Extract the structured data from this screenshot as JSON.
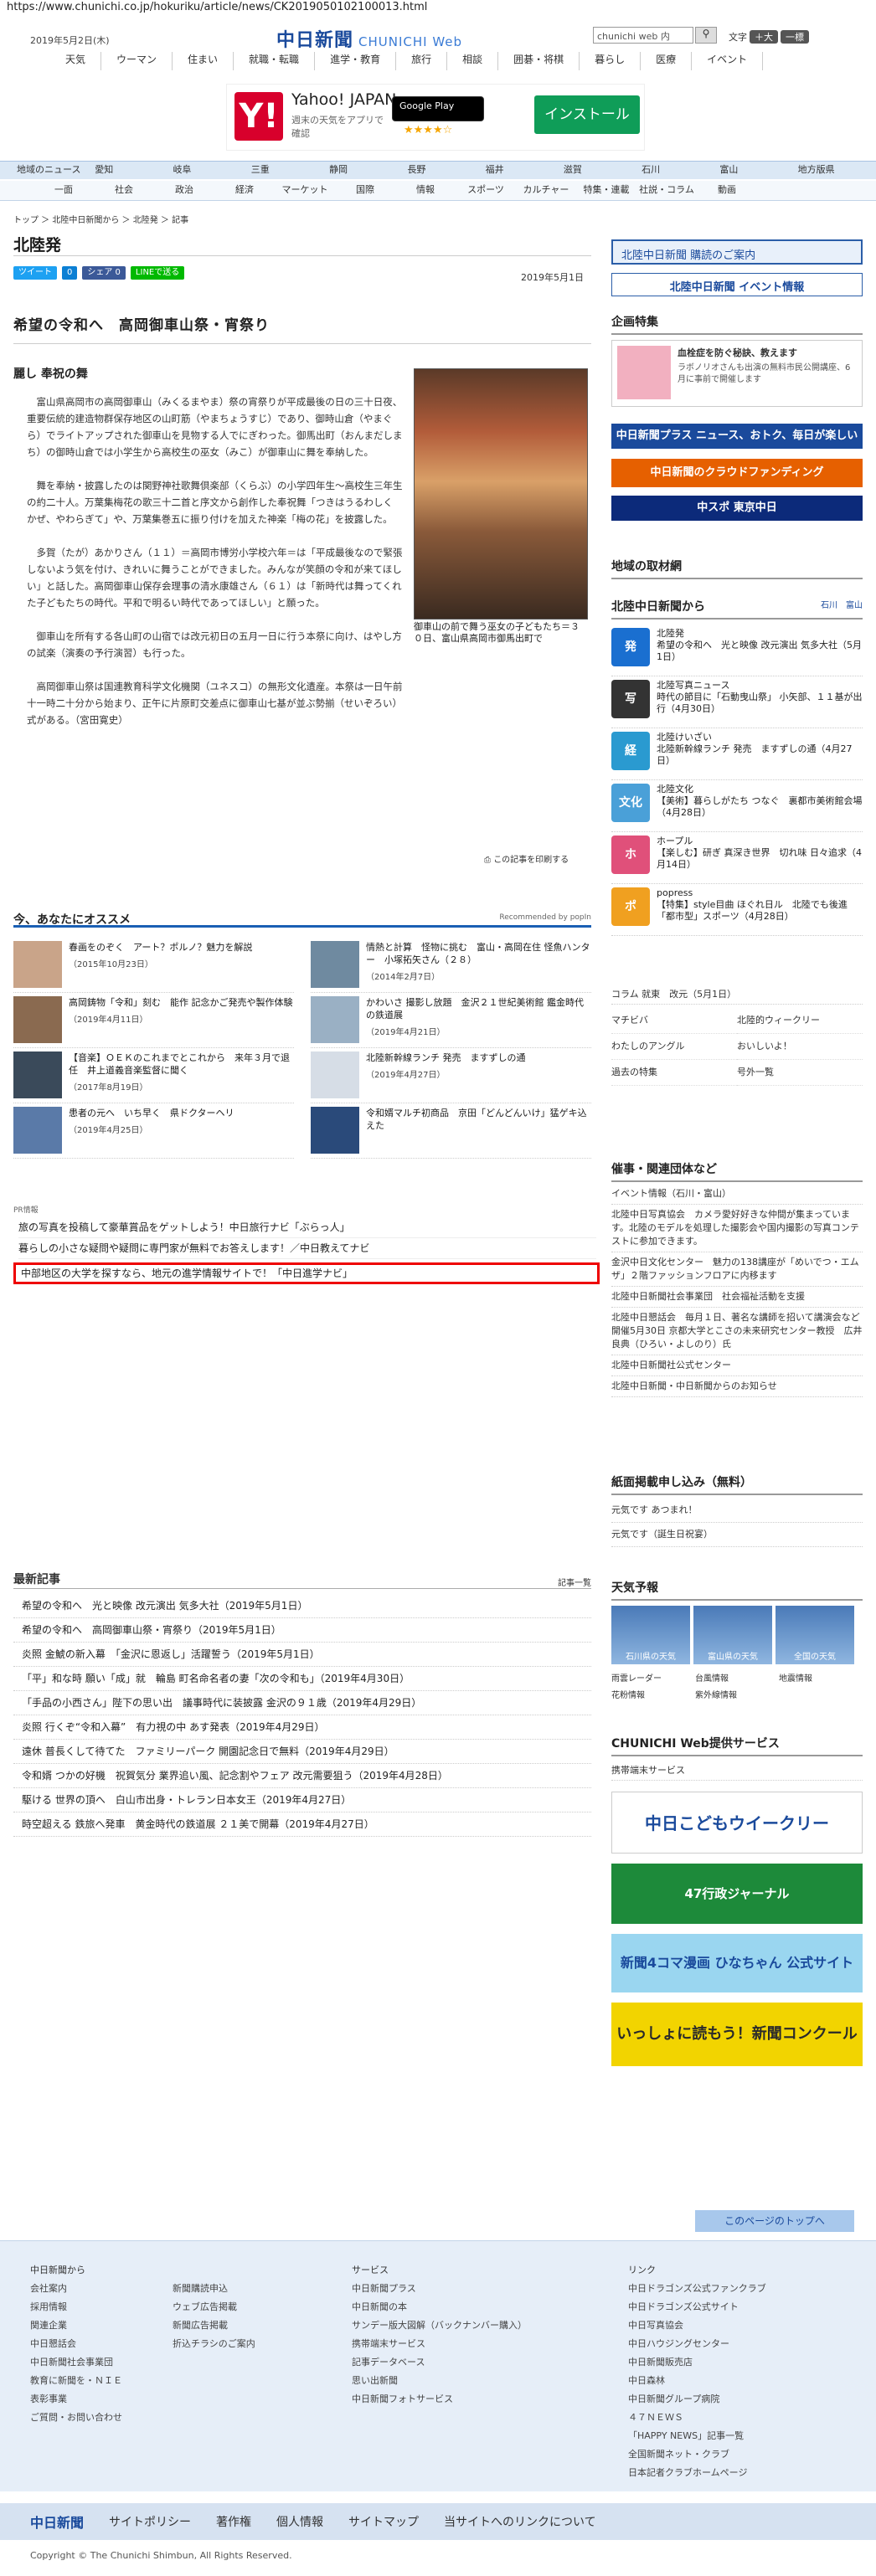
{
  "url": "https://www.chunichi.co.jp/hokuriku/article/news/CK2019050102100013.html",
  "header": {
    "date": "2019年5月2日(木)",
    "logo": "中日新聞",
    "logo_en": "CHUNICHI Web",
    "search_placeholder": "chunichi web 内",
    "font_label": "文字",
    "font_large": "＋大",
    "font_std": "一標",
    "nav": [
      "天気",
      "ウーマン",
      "住まい",
      "就職・転職",
      "進学・教育",
      "旅行",
      "相談",
      "囲碁・将棋",
      "暮らし",
      "医療",
      "イベント"
    ]
  },
  "ad": {
    "title": "Yahoo! JAPAN",
    "sub": "週末の天気をアプリで確認",
    "store": "Google Play",
    "stars": "★★★★☆",
    "install": "インストール"
  },
  "catnav": [
    "地域のニュース",
    "愛知",
    "岐阜",
    "三重",
    "静岡",
    "長野",
    "福井",
    "滋賀",
    "石川",
    "富山",
    "地方版県"
  ],
  "subnav": [
    "一面",
    "社会",
    "政治",
    "経済",
    "マーケット",
    "国際",
    "情報",
    "スポーツ",
    "カルチャー",
    "特集・連載",
    "社説・コラム",
    "動画"
  ],
  "breadcrumb": "トップ ＞ 北陸中日新聞から ＞ 北陸発 ＞ 記事",
  "section": "北陸発",
  "share": [
    "ツイート",
    "0",
    "シェア 0",
    "LINEで送る"
  ],
  "pubdate": "2019年5月1日",
  "article": {
    "title": "希望の令和へ　高岡御車山祭・宵祭り",
    "subtitle": "麗し 奉祝の舞",
    "paragraphs": [
      "富山県高岡市の高岡御車山（みくるまやま）祭の宵祭りが平成最後の日の三十日夜、重要伝統的建造物群保存地区の山町筋（やまちょうすじ）であり、御時山倉（やまぐら）でライトアップされた御車山を見物する人でにぎわった。御馬出町（おんまだしまち）の御時山倉では小学生から高校生の巫女（みこ）が御車山に舞を奉納した。",
      "舞を奉納・披露したのは関野神社歌舞倶楽部（くらぶ）の小学四年生〜高校生三年生の約二十人。万葉集梅花の歌三十二首と序文から創作した奉祝舞「つきはうるわしく　かぜ、やわらぎて」や、万葉集巻五に振り付けを加えた神楽「梅の花」を披露した。",
      "多賀（たが）あかりさん（１１）＝高岡市博労小学校六年＝は「平成最後なので緊張しないよう気を付け、きれいに舞うことができました。みんなが笑顔の令和が来てほしい」と話した。高岡御車山保存会理事の清水康雄さん（６１）は「新時代は舞ってくれた子どもたちの時代。平和で明るい時代であってほしい」と願った。",
      "御車山を所有する各山町の山宿では改元初日の五月一日に行う本祭に向け、はやし方の試楽（演奏の予行演習）も行った。",
      "高岡御車山祭は国連教育科学文化機関（ユネスコ）の無形文化遺産。本祭は一日午前十一時二十分から始まり、正午に片原町交差点に御車山七基が並ぶ勢揃（せいぞろい）式がある。（宮田寛史）"
    ],
    "caption": "御車山の前で舞う巫女の子どもたち＝３０日、富山県高岡市御馬出町で",
    "print": "この記事を印刷する"
  },
  "recommend": {
    "title": "今、あなたにオススメ",
    "by": "Recommended by popIn",
    "items": [
      {
        "t": "春画をのぞく　アート？ポルノ？魅力を解説",
        "d": "（2015年10月23日）"
      },
      {
        "t": "情熱と計算　怪物に挑む　富山・高岡在住 怪魚ハンター　小塚拓矢さん（２８）",
        "d": "（2014年2月7日）"
      },
      {
        "t": "高岡鋳物「令和」刻む　能作 記念かご発売や製作体験",
        "d": "（2019年4月11日）"
      },
      {
        "t": "かわいさ 撮影し放題　金沢２１世紀美術館 鑑金時代の鉄道展",
        "d": "（2019年4月21日）"
      },
      {
        "t": "【音楽】ＯＥＫのこれまでとこれから　来年３月で退任　井上道義音楽監督に聞く",
        "d": "（2017年8月19日）"
      },
      {
        "t": "北陸新幹線ランチ 発売　ますずしの通",
        "d": "（2019年4月27日）"
      },
      {
        "t": "患者の元へ　いち早く　県ドクターヘリ",
        "d": "（2019年4月25日）"
      },
      {
        "t": "令和婿マルチ初商品　京田「どんどんいけ」猛ゲキ込えた",
        "d": ""
      }
    ]
  },
  "pr": {
    "label": "PR情報",
    "items": [
      "旅の写真を投稿して豪華賞品をゲットしよう！中日旅行ナビ「ぶらっ人」",
      "暮らしの小さな疑問や疑問に専門家が無料でお答えします！／中日教えてナビ"
    ],
    "highlight": "中部地区の大学を探すなら、地元の進学情報サイトで！「中日進学ナビ」"
  },
  "latest": {
    "title": "最新記事",
    "link": "記事一覧",
    "items": [
      "希望の令和へ　光と映像 改元演出 気多大社（2019年5月1日）",
      "希望の令和へ　高岡御車山祭・宵祭り（2019年5月1日）",
      "炎照 金鯱の新入幕　「金沢に恩返し」活躍誓う（2019年5月1日）",
      "「平」和な時 願い「成」就　輪島 町名命名者の妻「次の令和も」（2019年4月30日）",
      "「手品の小西さん」陛下の思い出　議事時代に装披露 金沢の９１歳（2019年4月29日）",
      "炎照 行くぞ“令和入幕”　有力視の中 あす発表（2019年4月29日）",
      "遠休 普長くして待てた　ファミリーパーク 開園記念日で無料（2019年4月29日）",
      "令和婿 つかの好機　祝賀気分 業界追い風、記念割やフェア 改元需要狙う（2019年4月28日）",
      "駆ける 世界の頂へ　白山市出身・トレラン日本女王（2019年4月27日）",
      "時空超える 鉄旅へ発車　黄金時代の鉄道展 ２１美で開幕（2019年4月27日）"
    ]
  },
  "right": {
    "banner1": "北陸中日新聞 購読のご案内",
    "banner2": "北陸中日新聞 イベント情報",
    "kikaku": "企画特集",
    "kikaku_t": "血栓症を防ぐ秘訣、教えます",
    "kikaku_s": "ラボノリオさんも出演の無料市民公開講座、6月に事前で開催します",
    "b1": "中日新聞プラス ニュース、おトク、毎日が楽しいサービス",
    "b2": "中日新聞のクラウドファンディング",
    "b3": "中スポ 東京中日",
    "jisyu": "地域の取材網",
    "hokuriku": "北陸中日新聞から",
    "hokuriku_r": "石川　富山",
    "hk": [
      {
        "i": "発",
        "c": "#1a6fd0",
        "t": "北陸発\n希望の令和へ　光と映像 改元演出 気多大社（5月1日）"
      },
      {
        "i": "写",
        "c": "#333",
        "t": "北陸写真ニュース\n時代の節目に「石動曳山祭」 小矢部、１１基が出行（4月30日）"
      },
      {
        "i": "経",
        "c": "#2a9ad0",
        "t": "北陸けいざい\n北陸新幹線ランチ 発売　ますずしの通（4月27日）"
      },
      {
        "i": "文化",
        "c": "#4aa0d8",
        "t": "北陸文化\n【美術】暮らしがたち つなぐ　裏都市美術館会場（4月28日）"
      },
      {
        "i": "ホ",
        "c": "#e0507a",
        "t": "ホープル\n【楽しむ】研ぎ 真深き世界　切れ味 日々追求（4月14日）"
      },
      {
        "i": "ポ",
        "c": "#f0a020",
        "t": "popress\n【特集】style目曲 ほぐれ日ル　北陸でも後進「都市型」スポーツ（4月28日）"
      }
    ],
    "column": "コラム 就東　改元（5月1日）",
    "links": [
      "マチビバ",
      "北陸的ウィークリー",
      "わたしのアングル",
      "おいしいよ！",
      "過去の特集",
      "号外一覧"
    ],
    "events": "催事・関連団体など",
    "ev": [
      "イベント情報（石川・富山）",
      "北陸中日写真協会　カメラ愛好好きな仲間が集まっています。北陸のモデルを処理した撮影会や国内撮影の写真コンテストに参加できます。",
      "金沢中日文化センター　魅力の138講座が「めいでつ・エムザ」２階ファッションフロアに内移ます",
      "北陸中日新聞社会事業団　社会福祉活動を支援",
      "北陸中日懇話会　毎月１日、著名な講師を招いて講演会など開催5月30日 京都大学とこさの未来研究センター教授　広井 良典（ひろい・よしのり）氏",
      "北陸中日新聞社公式センター",
      "北陸中日新聞・中日新聞からのお知らせ"
    ],
    "paper": "紙面掲載申し込み（無料）",
    "paper_items": [
      "元気です あつまれ！",
      "元気です（誕生日祝宴）"
    ],
    "weather": "天気予報",
    "weather_items": [
      "石川県の天気",
      "富山県の天気",
      "全国の天気"
    ],
    "wlinks": [
      "雨雲レーダー",
      "台風情報",
      "地震情報",
      "花粉情報",
      "紫外線情報",
      ""
    ],
    "web": "CHUNICHI Web提供サービス",
    "web_item": "携帯端末サービス",
    "kodomo": "中日こどもウイークリー",
    "g47": "47行政ジャーナル",
    "yonkoma": "新聞4コマ漫画 ひなちゃん 公式サイト",
    "nie": "いっしょに読もう！新聞コンクール"
  },
  "totop": "このページのトップへ",
  "footer": {
    "c1h": "中日新聞から",
    "c1": [
      "会社案内",
      "採用情報",
      "関連企業",
      "中日懇話会",
      "中日新聞社会事業団",
      "教育に新聞を・ＮＩＥ",
      "表彰事業",
      "ご質問・お問い合わせ"
    ],
    "c2": [
      "新聞購読申込",
      "ウェブ広告掲載",
      "新聞広告掲載",
      "折込チラシのご案内"
    ],
    "c3h": "サービス",
    "c3": [
      "中日新聞プラス",
      "中日新聞の本",
      "サンデー版大図解（バックナンバー購入）",
      "携帯端末サービス",
      "記事データベース",
      "思い出新聞",
      "中日新聞フォトサービス"
    ],
    "c4h": "リンク",
    "c4": [
      "中日ドラゴンズ公式ファンクラブ",
      "中日ドラゴンズ公式サイト",
      "中日写真協会",
      "中日ハウジングセンター",
      "中日新聞販売店",
      "中日森林",
      "中日新聞グループ病院",
      "４７ＮＥＷＳ",
      "「HAPPY NEWS」記事一覧",
      "全国新聞ネット・クラブ",
      "日本記者クラブホームページ"
    ]
  },
  "fbar": [
    "中日新聞",
    "サイトポリシー",
    "著作権",
    "個人情報",
    "サイトマップ",
    "当サイトへのリンクについて"
  ],
  "copyright": "Copyright © The Chunichi Shimbun, All Rights Reserved."
}
